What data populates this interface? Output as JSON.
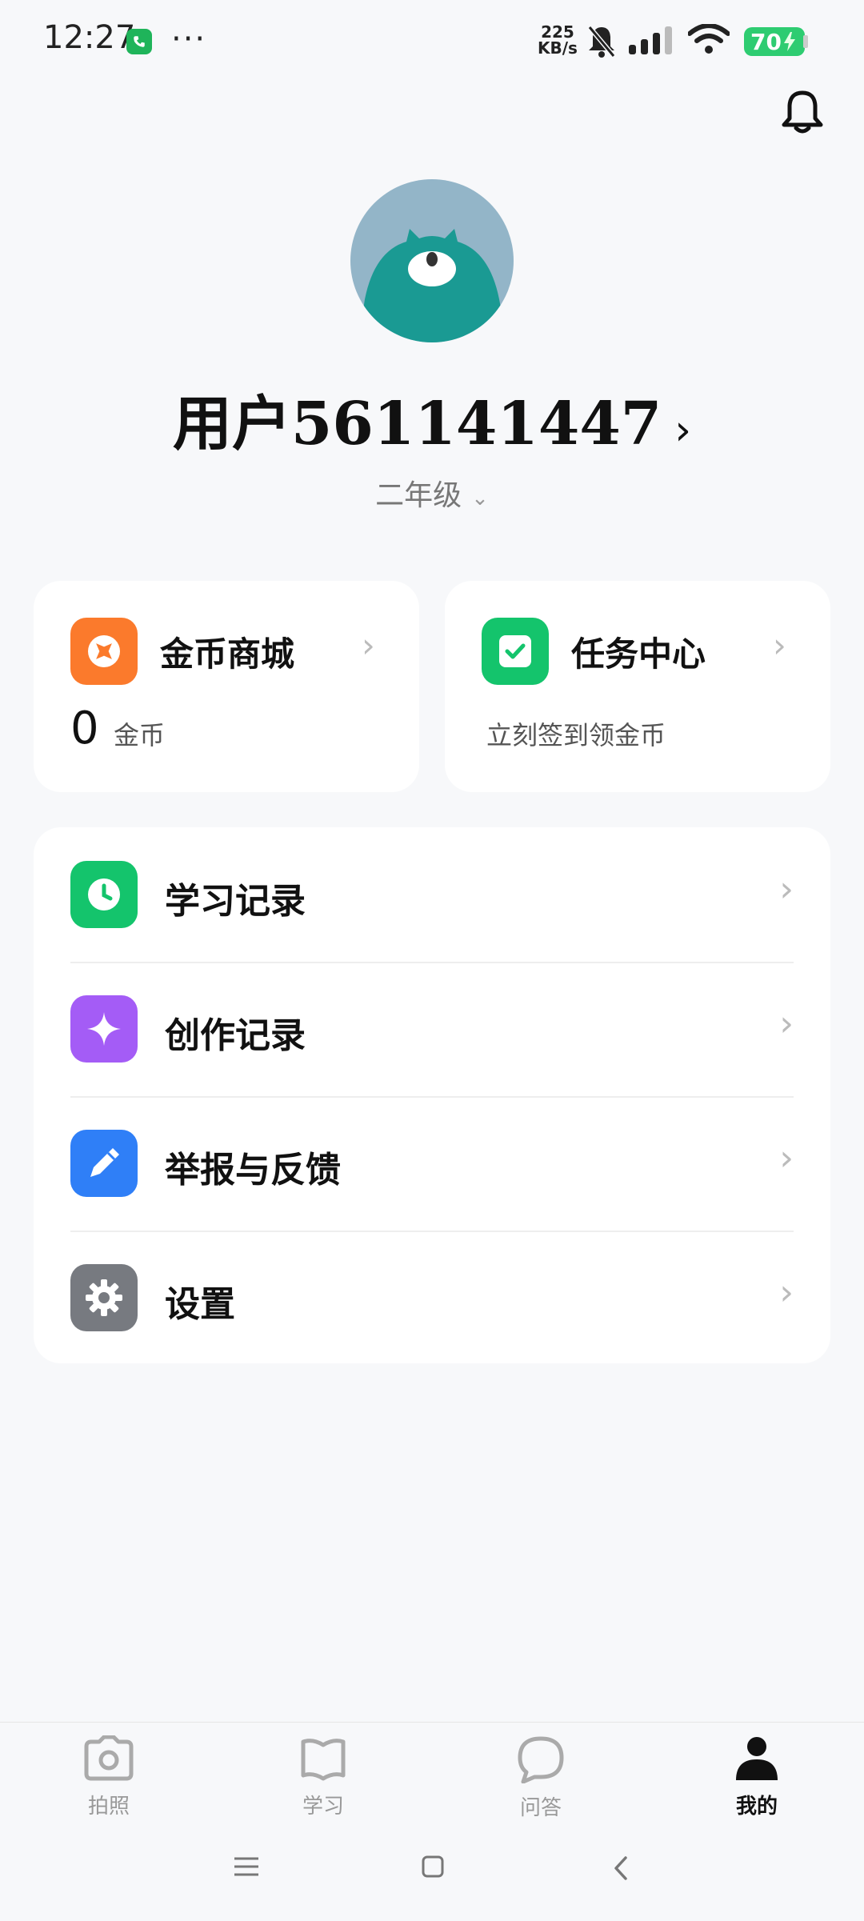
{
  "status_bar": {
    "time": "12:27",
    "dots": "···",
    "net_speed_value": "225",
    "net_speed_unit": "KB/s",
    "battery": "70"
  },
  "profile": {
    "username": "用户561141447",
    "chevron": "›",
    "grade": "二年级",
    "grade_chevron": "⌄"
  },
  "cards": {
    "coin_mall": {
      "title": "金币商城",
      "count": "0",
      "unit": "金币"
    },
    "task_center": {
      "title": "任务中心",
      "subtitle": "立刻签到领金币"
    }
  },
  "menu": [
    {
      "label": "学习记录",
      "icon": "clock-icon",
      "color": "#14c46c"
    },
    {
      "label": "创作记录",
      "icon": "sparkle-icon",
      "color": "#a45cf6"
    },
    {
      "label": "举报与反馈",
      "icon": "pen-icon",
      "color": "#2f7ff7"
    },
    {
      "label": "设置",
      "icon": "gear-icon",
      "color": "#777a80"
    }
  ],
  "tabs": [
    {
      "label": "拍照",
      "icon": "camera-icon"
    },
    {
      "label": "学习",
      "icon": "book-icon"
    },
    {
      "label": "问答",
      "icon": "chat-icon"
    },
    {
      "label": "我的",
      "icon": "person-icon",
      "active": true
    }
  ],
  "colors": {
    "background": "#f7f8fa",
    "coin_icon": "#fb7a2c",
    "task_icon": "#14c46c",
    "battery": "#2ecc71"
  }
}
